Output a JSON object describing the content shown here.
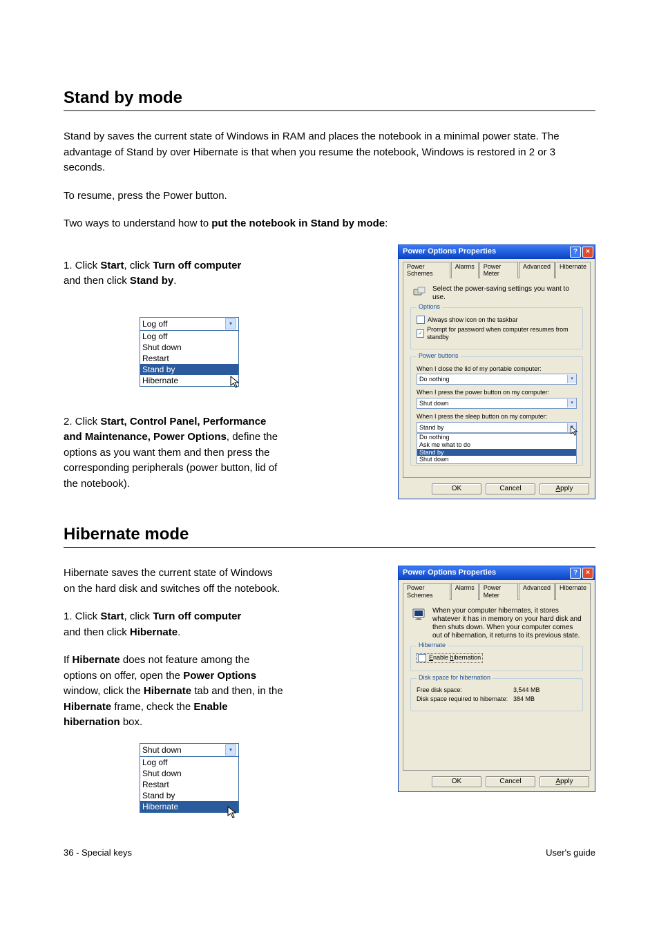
{
  "section": {
    "title": "Stand by mode"
  },
  "standby": {
    "intro": "Stand by saves the current state of Windows in RAM and places the notebook in a minimal power state. The advantage of Stand by over Hibernate is that when you resume the notebook, Windows is restored in 2 or 3 seconds.",
    "resume": "To resume, press the Power button.",
    "how_intro_prefix": "Two ways to understand how to ",
    "how_intro_bold": "put the notebook in Stand by mode",
    "how_intro_suffix": ":",
    "step1_prefix": "1. Click ",
    "step1_b1": "Start",
    "step1_mid": ", click ",
    "step1_b2": "Turn off computer",
    "step1_mid2": "\nand then click ",
    "step1_b3": "Stand by",
    "step1_end": ".",
    "step2_prefix": "2. Click ",
    "step2_path": "Start, Control Panel, Performance and Maintenance, Power Options",
    "step2_mid": ", define the options as you want them and then press the corresponding peripherals (power button, lid of the notebook)."
  },
  "combo_standby": {
    "selected": "Log off",
    "options": [
      "Log off",
      "Shut down",
      "Restart",
      "Stand by",
      "Hibernate"
    ],
    "highlight": "Stand by"
  },
  "dialog_adv": {
    "title": "Power Options Properties",
    "tabs": [
      "Power Schemes",
      "Alarms",
      "Power Meter",
      "Advanced",
      "Hibernate"
    ],
    "active_tab": "Advanced",
    "desc": "Select the power-saving settings you want to use.",
    "options_legend": "Options",
    "opt_icon": "Always show icon on the taskbar",
    "opt_pw": "Prompt for password when computer resumes from standby",
    "pb_legend": "Power buttons",
    "lbl_lid": "When I close the lid of my portable computer:",
    "sel_lid": "Do nothing",
    "lbl_power": "When I press the power button on my computer:",
    "sel_power": "Shut down",
    "lbl_sleep": "When I press the sleep button on my computer:",
    "sel_sleep": "Stand by",
    "sleep_options": [
      "Do nothing",
      "Ask me what to do",
      "Stand by",
      "Shut down"
    ],
    "sleep_highlight": "Stand by",
    "btn_ok": "OK",
    "btn_cancel": "Cancel",
    "btn_apply": "Apply"
  },
  "hibernate": {
    "title": "Hibernate mode",
    "intro": "Hibernate saves the current state of Windows on the hard disk and switches off the notebook.",
    "step1_prefix": "1. Click ",
    "step1_b1": "Start",
    "step1_mid": ", click ",
    "step1_b2": "Turn off computer",
    "step1_mid2": "\nand then click ",
    "step1_b3": "Hibernate",
    "step1_end": ".",
    "note_prefix": "If ",
    "note_b1": "Hibernate",
    "note_mid1": " does not feature among the options on offer, open the ",
    "note_b2": "Power Options",
    "note_mid2": " window, click the ",
    "note_b3": "Hibernate",
    "note_mid3": " tab and then, in the ",
    "note_b4": "Hibernate",
    "note_mid4": " frame, check the ",
    "note_b5": "Enable hibernation",
    "note_end": " box."
  },
  "combo_hib": {
    "selected": "Shut down",
    "options": [
      "Log off",
      "Shut down",
      "Restart",
      "Stand by",
      "Hibernate"
    ],
    "highlight": "Hibernate"
  },
  "dialog_hib": {
    "title": "Power Options Properties",
    "tabs": [
      "Power Schemes",
      "Alarms",
      "Power Meter",
      "Advanced",
      "Hibernate"
    ],
    "active_tab": "Hibernate",
    "desc": "When your computer hibernates, it stores whatever it has in memory on your hard disk and then shuts down. When your computer comes out of hibernation, it returns to its previous state.",
    "hib_legend": "Hibernate",
    "enable_label": "Enable hibernation",
    "ds_legend": "Disk space for hibernation",
    "free_label": "Free disk space:",
    "free_value": "3,544 MB",
    "req_label": "Disk space required to hibernate:",
    "req_value": "384 MB",
    "btn_ok": "OK",
    "btn_cancel": "Cancel",
    "btn_apply": "Apply"
  },
  "footer": {
    "left": "36 - Special keys",
    "right": "User's guide"
  }
}
